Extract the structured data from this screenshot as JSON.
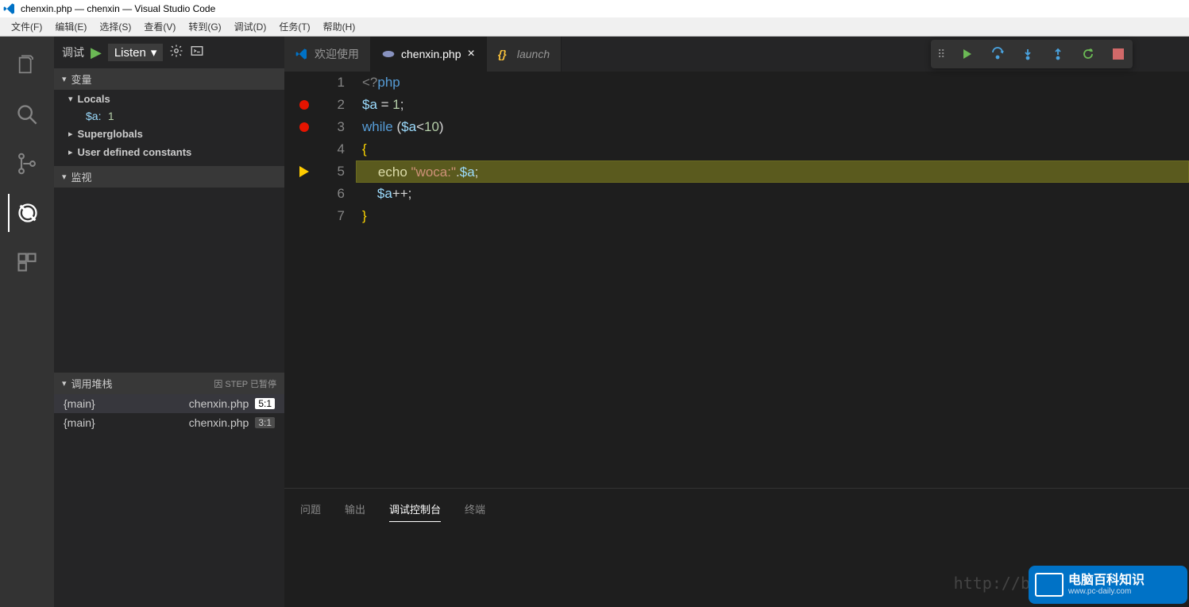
{
  "title_bar": "chenxin.php — chenxin — Visual Studio Code",
  "menu": [
    "文件(F)",
    "编辑(E)",
    "选择(S)",
    "查看(V)",
    "转到(G)",
    "调试(D)",
    "任务(T)",
    "帮助(H)"
  ],
  "debug_header": {
    "label": "调试",
    "config": "Listen"
  },
  "sections": {
    "variables": "变量",
    "locals": "Locals",
    "superglobals": "Superglobals",
    "user_constants": "User defined constants",
    "watch": "监视",
    "callstack": "调用堆栈",
    "callstack_status": "因 STEP 已暂停"
  },
  "vars": {
    "a_name": "$a:",
    "a_value": "1"
  },
  "callstack": [
    {
      "frame": "{main}",
      "file": "chenxin.php",
      "line": "5:1",
      "active": true
    },
    {
      "frame": "{main}",
      "file": "chenxin.php",
      "line": "3:1",
      "active": false
    }
  ],
  "tabs": [
    {
      "label": "欢迎使用",
      "icon": "vs",
      "active": false,
      "italic": false
    },
    {
      "label": "chenxin.php",
      "icon": "php",
      "active": true,
      "italic": false
    },
    {
      "label": "launch",
      "icon": "json",
      "active": false,
      "italic": true
    }
  ],
  "code": {
    "lines": [
      "1",
      "2",
      "3",
      "4",
      "5",
      "6",
      "7"
    ],
    "breakpoints": [
      2,
      3
    ],
    "current": 5,
    "content": [
      {
        "tokens": [
          [
            "tag",
            "<?"
          ],
          [
            "keyword",
            "php"
          ]
        ]
      },
      {
        "tokens": [
          [
            "var",
            "$a"
          ],
          [
            "op",
            " = "
          ],
          [
            "num",
            "1"
          ],
          [
            "op",
            ";"
          ]
        ]
      },
      {
        "tokens": [
          [
            "keyword",
            "while"
          ],
          [
            "op",
            " ("
          ],
          [
            "var",
            "$a"
          ],
          [
            "op",
            "<"
          ],
          [
            "num",
            "10"
          ],
          [
            "op",
            ")"
          ]
        ]
      },
      {
        "tokens": [
          [
            "brace",
            "{"
          ]
        ]
      },
      {
        "tokens": [
          [
            "op",
            "    "
          ],
          [
            "func",
            "echo"
          ],
          [
            "op",
            " "
          ],
          [
            "str",
            "\"woca:\""
          ],
          [
            "op",
            "."
          ],
          [
            "var",
            "$a"
          ],
          [
            "op",
            ";"
          ]
        ]
      },
      {
        "tokens": [
          [
            "op",
            "    "
          ],
          [
            "var",
            "$a"
          ],
          [
            "op",
            "++;"
          ]
        ]
      },
      {
        "tokens": [
          [
            "brace",
            "}"
          ]
        ]
      }
    ]
  },
  "panel_tabs": [
    "问题",
    "输出",
    "调试控制台",
    "终端"
  ],
  "panel_active": 2,
  "watermark": "http://b",
  "logo": {
    "line1": "电脑百科知识",
    "line2": "www.pc-daily.com"
  }
}
